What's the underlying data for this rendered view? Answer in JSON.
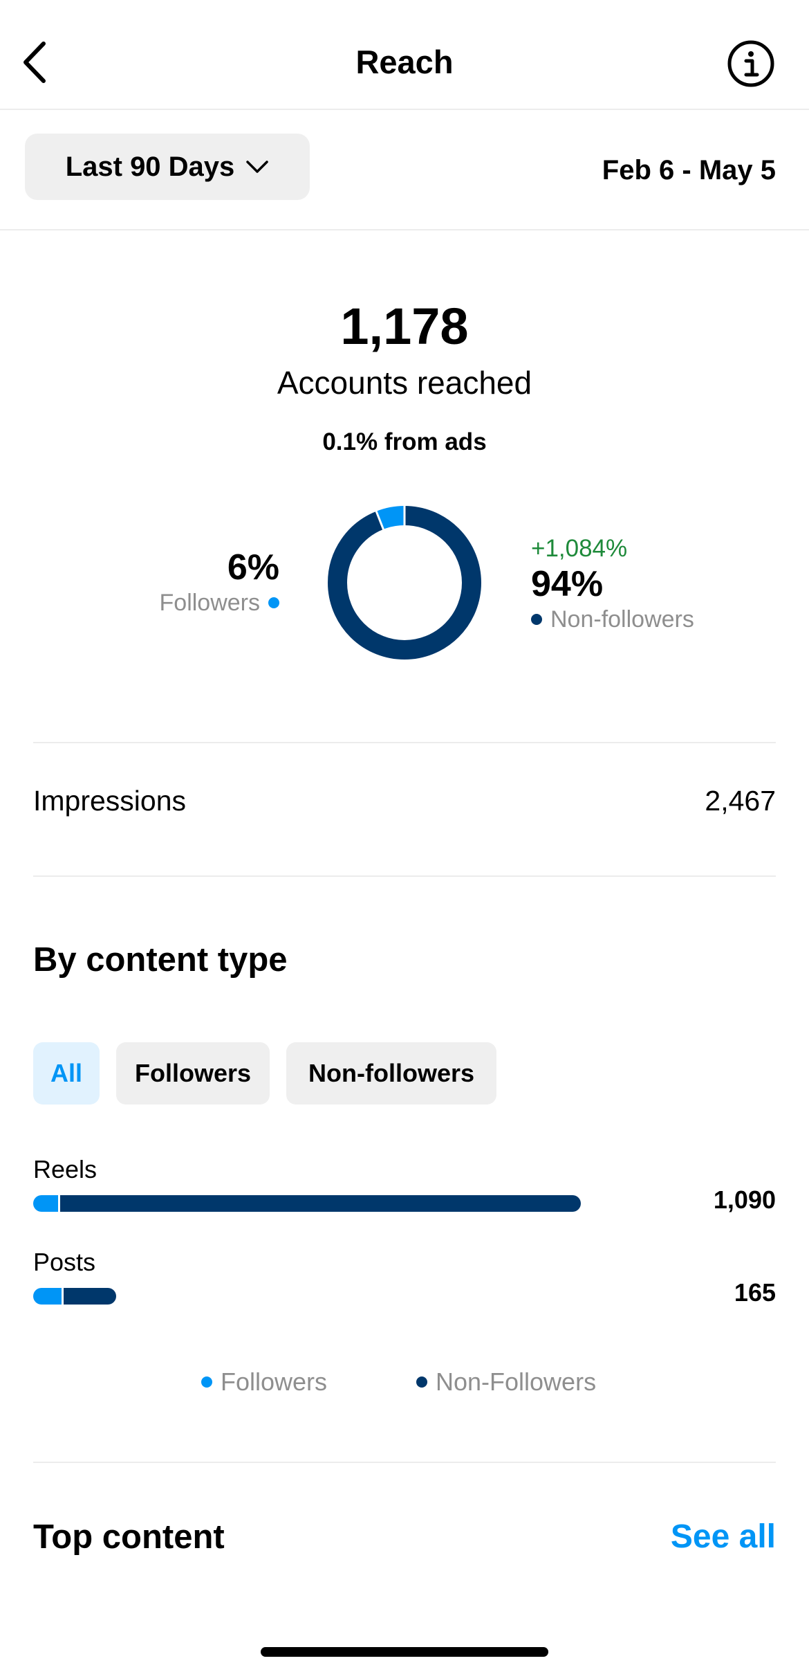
{
  "header": {
    "title": "Reach",
    "back_icon": "chevron-left-icon",
    "info_icon": "info-icon"
  },
  "filter": {
    "range_label": "Last 90 Days",
    "dropdown_icon": "chevron-down-icon",
    "date_range": "Feb 6 - May 5"
  },
  "summary": {
    "accounts_count": "1,178",
    "accounts_label": "Accounts reached",
    "ads_note": "0.1% from ads",
    "followers_pct": "6%",
    "followers_label": "Followers",
    "nonfollowers_change": "+1,084%",
    "nonfollowers_pct": "94%",
    "nonfollowers_label": "Non-followers"
  },
  "impressions": {
    "label": "Impressions",
    "value": "2,467"
  },
  "by_content": {
    "title": "By content type",
    "chips": [
      "All",
      "Followers",
      "Non-followers"
    ],
    "active_chip": "All",
    "rows": [
      {
        "label": "Reels",
        "value": "1,090"
      },
      {
        "label": "Posts",
        "value": "165"
      }
    ],
    "legend": [
      "Followers",
      "Non-Followers"
    ]
  },
  "top_content": {
    "title": "Top content",
    "see_all": "See all"
  },
  "colors": {
    "followers": "#0095f6",
    "non_followers": "#00376b",
    "accent": "#0095f6",
    "positive_change": "#1e8a3a"
  },
  "chart_data": [
    {
      "type": "pie",
      "categories": [
        "Followers",
        "Non-followers"
      ],
      "values": [
        6,
        94
      ]
    },
    {
      "type": "bar",
      "categories": [
        "Reels",
        "Posts"
      ],
      "series": [
        {
          "name": "Followers",
          "values": [
            53,
            60
          ]
        },
        {
          "name": "Non-Followers",
          "values": [
            1037,
            105
          ]
        }
      ],
      "totals": [
        1090,
        165
      ]
    }
  ]
}
